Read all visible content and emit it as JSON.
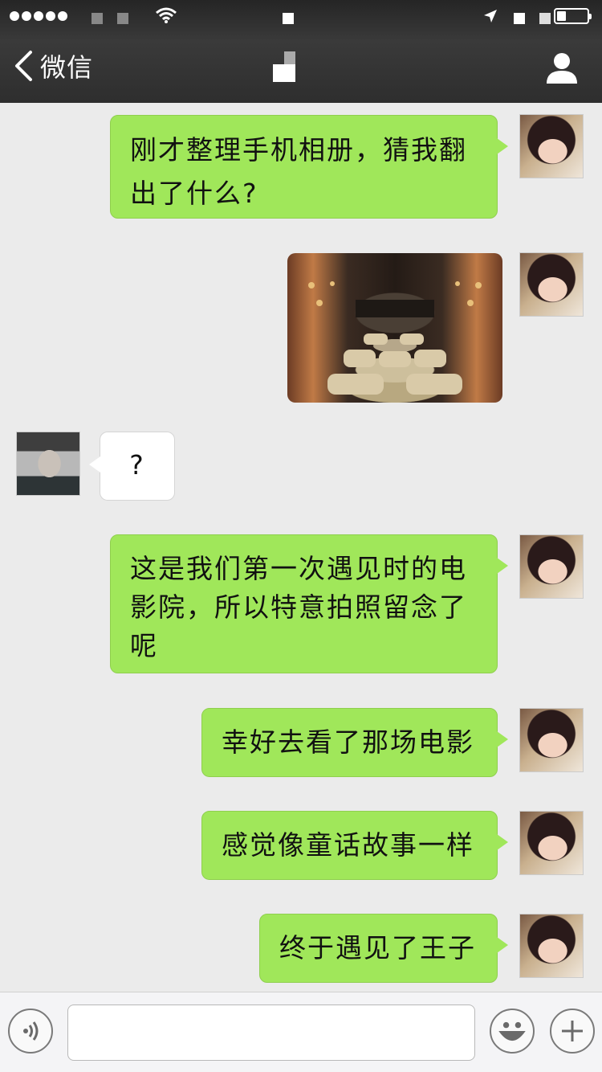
{
  "status_bar": {
    "signal_dots": 5,
    "battery_level": 0.3
  },
  "nav": {
    "back_label": "微信",
    "title": "",
    "profile_icon": "person-icon"
  },
  "messages": [
    {
      "from": "me",
      "type": "text",
      "lines": [
        "刚才整理手机相册，猜我翻",
        "出了什么?"
      ]
    },
    {
      "from": "me",
      "type": "image",
      "description_icon": "cinema-photo"
    },
    {
      "from": "other",
      "type": "text",
      "lines": [
        "?"
      ]
    },
    {
      "from": "me",
      "type": "text",
      "lines": [
        "这是我们第一次遇见时的电",
        "影院，所以特意拍照留念了",
        "呢"
      ]
    },
    {
      "from": "me",
      "type": "text",
      "lines": [
        "幸好去看了那场电影"
      ]
    },
    {
      "from": "me",
      "type": "text",
      "lines": [
        "感觉像童话故事一样"
      ]
    },
    {
      "from": "me",
      "type": "text",
      "lines": [
        "终于遇见了王子"
      ]
    }
  ],
  "input_bar": {
    "voice_icon": "voice-icon",
    "input_value": "",
    "input_placeholder": "",
    "emoji_icon": "smiley-icon",
    "plus_icon": "plus-icon"
  },
  "colors": {
    "my_bubble": "#a0e75a",
    "other_bubble": "#ffffff",
    "background": "#ebebeb",
    "nav_bg": "#2e2e2e"
  }
}
